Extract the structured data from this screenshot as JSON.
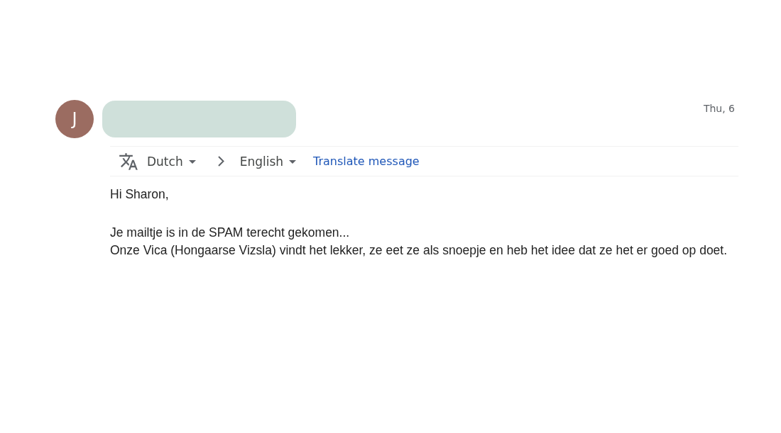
{
  "message": {
    "sender": {
      "initial": "J"
    },
    "date": "Thu, 6"
  },
  "translate_bar": {
    "source_language": "Dutch",
    "target_language": "English",
    "translate_link": "Translate message"
  },
  "body": {
    "greeting": "Hi Sharon,",
    "lines": [
      "Je mailtje is in de SPAM terecht gekomen...",
      "Onze Vica (Hongaarse Vizsla) vindt het lekker, ze eet ze als snoepje en heb het idee dat ze het er goed op doet."
    ]
  }
}
